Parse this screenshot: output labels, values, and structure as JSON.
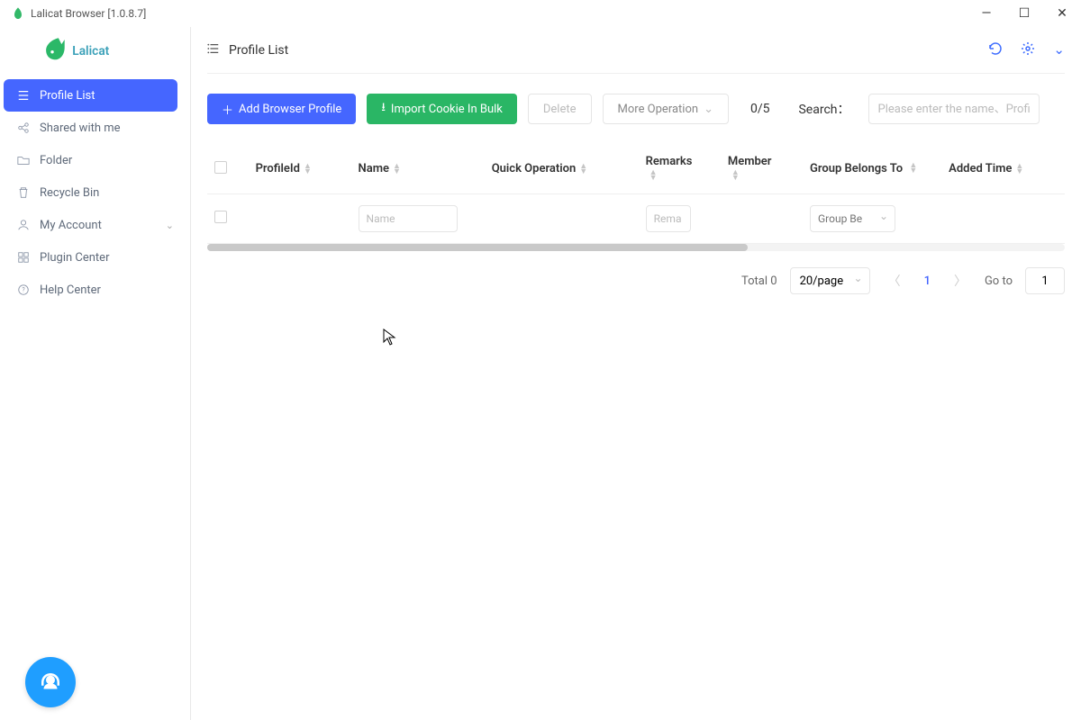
{
  "window": {
    "title": "Lalicat Browser  [1.0.8.7]"
  },
  "brand": {
    "name": "Lalicat",
    "accent": "#4566ff",
    "green": "#2ab665"
  },
  "sidebar": {
    "items": [
      {
        "label": "Profile List",
        "icon": "list-icon",
        "active": true
      },
      {
        "label": "Shared with me",
        "icon": "share-icon",
        "active": false
      },
      {
        "label": "Folder",
        "icon": "folder-icon",
        "active": false
      },
      {
        "label": "Recycle Bin",
        "icon": "trash-icon",
        "active": false
      },
      {
        "label": "My Account",
        "icon": "user-icon",
        "active": false,
        "expandable": true
      },
      {
        "label": "Plugin Center",
        "icon": "plugin-icon",
        "active": false
      },
      {
        "label": "Help Center",
        "icon": "help-icon",
        "active": false
      }
    ]
  },
  "topbar": {
    "title": "Profile List"
  },
  "toolbar": {
    "add_label": "Add Browser Profile",
    "import_label": "Import Cookie In Bulk",
    "delete_label": "Delete",
    "more_label": "More Operation",
    "count": "0/5",
    "search_label": "Search：",
    "search_placeholder": "Please enter the name、ProfileId"
  },
  "table": {
    "columns": {
      "profile_id": "ProfileId",
      "name": "Name",
      "quick_op": "Quick Operation",
      "remarks": "Remarks",
      "member": "Member",
      "group": "Group Belongs To",
      "added_time": "Added Time"
    },
    "filters": {
      "name_placeholder": "Name",
      "remarks_placeholder": "Rema",
      "group_placeholder": "Group Be"
    }
  },
  "pagination": {
    "total_label": "Total 0",
    "page_size": "20/page",
    "current_page": "1",
    "goto_label": "Go to",
    "goto_value": "1"
  }
}
